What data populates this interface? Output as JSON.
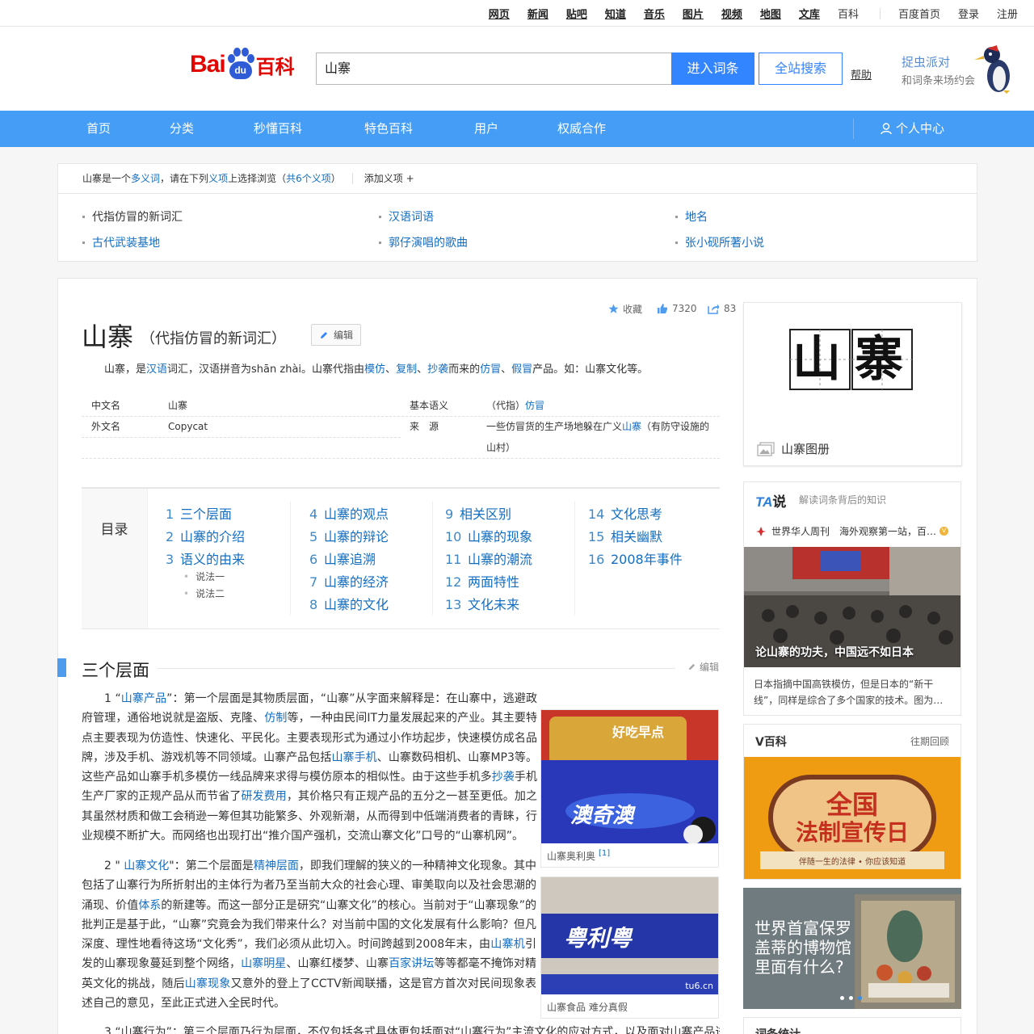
{
  "topbar": {
    "links": [
      "网页",
      "新闻",
      "贴吧",
      "知道",
      "音乐",
      "图片",
      "视频",
      "地图",
      "文库",
      "百科"
    ],
    "right": [
      "百度首页",
      "登录",
      "注册"
    ]
  },
  "header": {
    "logo_bai": "Bai",
    "logo_du": "du",
    "logo_baike": "百科",
    "search_value": "山寨",
    "enter_label": "进入词条",
    "site_label": "全站搜索",
    "help_label": "帮助",
    "promo_title": "捉虫派对",
    "promo_sub": "和词条来场约会"
  },
  "nav": {
    "items": [
      "首页",
      "分类",
      "秒懂百科",
      "特色百科",
      "用户",
      "权威合作"
    ],
    "personal": "个人中心"
  },
  "polysemy": {
    "term": "山寨",
    "text1": "是一个",
    "link1": "多义词",
    "text2": "，请在下列",
    "link2": "义项",
    "text3": "上选择浏览（",
    "link3": "共6个义项",
    "text4": "）",
    "add": "添加义项",
    "items": [
      "代指仿冒的新词汇",
      "汉语词语",
      "地名",
      "古代武装基地",
      "郭仔演唱的歌曲",
      "张小砚所著小说"
    ]
  },
  "entry": {
    "title": "山寨",
    "subtitle": "（代指仿冒的新词汇）",
    "edit": "编辑",
    "collect": "收藏",
    "likes": "7320",
    "shares": "83",
    "intro": {
      "a": "山寨，是",
      "l1": "汉语",
      "b": "词汇，汉语拼音为shān zhài。山寨代指由",
      "l2": "模仿",
      "c": "、",
      "l3": "复制",
      "d": "、",
      "l4": "抄袭",
      "e": "而来的",
      "l5": "仿冒",
      "f": "、",
      "l6": "假冒",
      "g": "产品。如：山寨文化等。"
    },
    "basic": {
      "k1": "中文名",
      "v1": "山寨",
      "k2": "外文名",
      "v2": "Copycat",
      "k3": "基本语义",
      "v3a": "（代指）",
      "v3b": "仿冒",
      "k4": "来　源",
      "v4a": "一些仿冒货的生产场地躲在广义",
      "v4b": "山寨",
      "v4c": "（有防守设施的",
      "v4d": "山村）"
    }
  },
  "toc": {
    "label": "目录",
    "items": [
      {
        "n": "1",
        "t": "三个层面"
      },
      {
        "n": "2",
        "t": "山寨的介绍"
      },
      {
        "n": "3",
        "t": "语义的由来"
      },
      {
        "n": "4",
        "t": "山寨的观点"
      },
      {
        "n": "5",
        "t": "山寨的辩论"
      },
      {
        "n": "6",
        "t": "山寨追溯"
      },
      {
        "n": "7",
        "t": "山寨的经济"
      },
      {
        "n": "8",
        "t": "山寨的文化"
      },
      {
        "n": "9",
        "t": "相关区别"
      },
      {
        "n": "10",
        "t": "山寨的现象"
      },
      {
        "n": "11",
        "t": "山寨的潮流"
      },
      {
        "n": "12",
        "t": "两面特性"
      },
      {
        "n": "13",
        "t": "文化未来"
      },
      {
        "n": "14",
        "t": "文化思考"
      },
      {
        "n": "15",
        "t": "相关幽默"
      },
      {
        "n": "16",
        "t": "2008年事件"
      }
    ],
    "subs": [
      "说法一",
      "说法二"
    ]
  },
  "section": {
    "title": "三个层面",
    "edit": "编辑",
    "p1": {
      "a": "1 “",
      "l1": "山寨产品",
      "b": "”：第一个层面是其物质层面，“山寨”从字面来解释是：在山寨中，逃避政府管理，通俗地说就是盗版、克隆、",
      "l2": "仿制",
      "c": "等，一种由民间IT力量发展起来的产业。其主要特点主要表现为仿造性、快速化、平民化。主要表现形式为通过小作坊起步，快速模仿成名品牌，涉及手机、游戏机等不同领域。山寨产品包括",
      "l3": "山寨手机",
      "d": "、山寨数码相机、山寨MP3等。这些产品如山寨手机多模仿一线品牌来求得与模仿原本的相似性。由于这些手机多",
      "l4": "抄袭",
      "e": "手机生产厂家的正规产品从而节省了",
      "l5": "研发费用",
      "f": "，其价格只有正规产品的五分之一甚至更低。加之其虽然材质和做工会稍逊一筹但其功能繁多、外观新潮，从而得到中低端消费者的青睐，行业规模不断扩大。而网络也出现打出“推介国产强机，交流山寨文化”口号的“山寨机网”。"
    },
    "p2": {
      "a": "2 \" ",
      "l1": "山寨文化",
      "b": "\"：第二个层面是",
      "l2": "精神层面",
      "c": "，即我们理解的狭义的一种精神文化现象。其中包括了山寨行为所折射出的主体行为者乃至当前大众的社会心理、审美取向以及社会思潮的涌现、价值",
      "l3": "体系",
      "d": "的新建等。而这一部分正是研究“山寨文化”的核心。当前对于“山寨现象”的批判正是基于此，“山寨”究竟会为我们带来什么？对当前中国的文化发展有什么影响？但凡深度、理性地看待这场“文化秀”，我们必须从此切入。时间跨越到2008年末，由",
      "l4": "山寨机",
      "e": "引发的山寨现象蔓延到整个网络，",
      "l5": "山寨明星",
      "f": "、山寨红楼梦、山寨",
      "l6": "百家讲坛",
      "g": "等等都毫不掩饰对精英文化的挑战，随后",
      "l7": "山寨现象",
      "h": "又意外的登上了CCTV新闻联播，这是官方首次对民间现象表述自己的意见，至此正式进入全民时代。"
    },
    "p3": "3 “山寨行为”：第三个层面乃行为层面，不仅包括各式具体更包括面对“山寨行为”主流文化的应对方式，以及面对山寨产品进",
    "fig1_caption": "山寨奥利奥",
    "fig1_ref": "[1]",
    "fig1_pack_top": "好吃早点",
    "fig1_pack_bottom": "澳奇澳",
    "fig2_caption": "山寨食品 难分真假",
    "fig2_pack": "粤利粤",
    "fig2_wm": "tu6.cn"
  },
  "sidebar": {
    "album_chars": [
      "山",
      "寨"
    ],
    "album_caption": "山寨图册",
    "ta_logo": "TA",
    "ta_logo2": "说",
    "ta_slogan": "解读词条背后的知识",
    "ta_source": "世界华人周刊",
    "ta_source_desc": "海外观察第一站，百…",
    "ta_photo_caption": "论山寨的功夫，中国远不如日本",
    "ta_desc": "日本指摘中国高铁模仿，但是日本的“新干线”，同样是综合了多个国家的技术。图为…",
    "vbk_title": "V百科",
    "vbk_more": "往期回顾",
    "vbk_poster_l1": "全国",
    "vbk_poster_l2": "法制宣传日",
    "vbk_poster_l3": "伴随一生的法律 • 你应该知道",
    "museum_text": "世界首富保罗盖蒂的博物馆里面有什么?",
    "stat_title": "词条统计"
  },
  "colors": {
    "accent": "#459df5",
    "link": "#136ec2",
    "logo_red": "#e10601",
    "logo_blue": "#2f5bd6"
  }
}
